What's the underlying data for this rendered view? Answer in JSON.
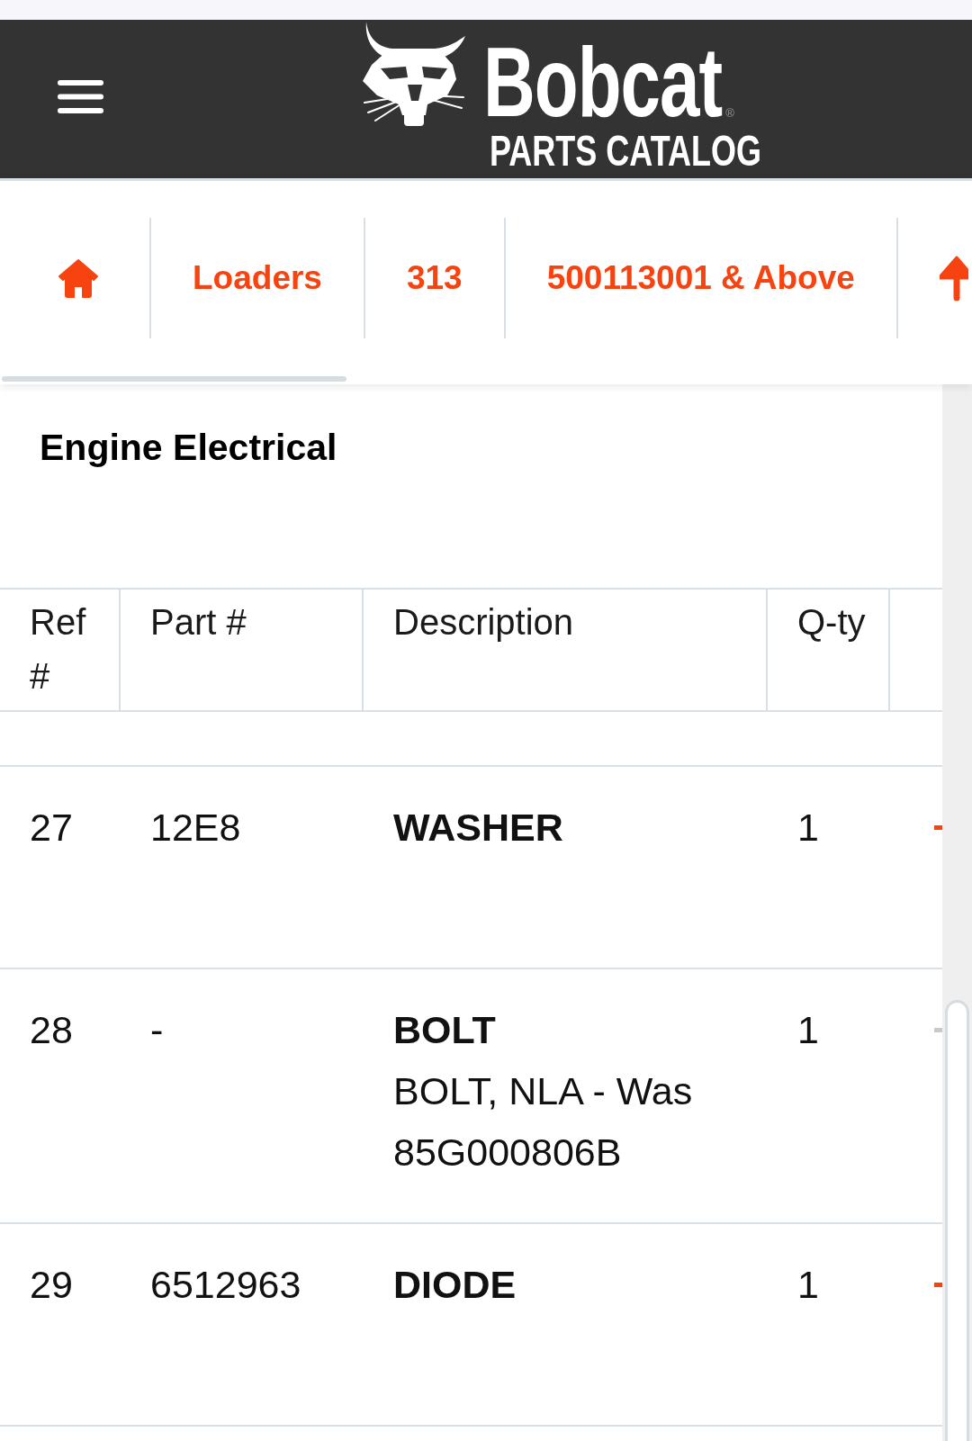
{
  "header": {
    "logo": {
      "wordmark": "Bobcat",
      "registered_mark": "®",
      "subtitle": "PARTS CATALOG"
    }
  },
  "breadcrumb": {
    "items": [
      {
        "kind": "home"
      },
      {
        "kind": "link",
        "label": "Loaders"
      },
      {
        "kind": "link",
        "label": "313"
      },
      {
        "kind": "link",
        "label": "500113001 & Above"
      },
      {
        "kind": "up"
      }
    ]
  },
  "page_title": "Engine Electrical",
  "table": {
    "columns": [
      "Ref #",
      "Part #",
      "Description",
      "Q-ty"
    ],
    "rows": [
      {
        "ref": "27",
        "part_number": "12E8",
        "name": "WASHER",
        "qty": "1",
        "action_disabled": false
      },
      {
        "ref": "28",
        "part_number": "-",
        "name": "BOLT",
        "note": "BOLT, NLA - Was 85G000806B",
        "qty": "1",
        "action_disabled": true
      },
      {
        "ref": "29",
        "part_number": "6512963",
        "name": "DIODE",
        "qty": "1",
        "action_disabled": false
      }
    ]
  }
}
